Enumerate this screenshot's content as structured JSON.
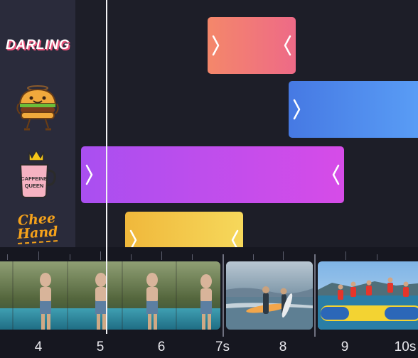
{
  "stickers": {
    "darling_text": "DARLING",
    "burger_icon": "burger-icon",
    "coffee_icon": "caffeine-queen-mug-icon",
    "coffee_text_1": "CAFFEINE",
    "coffee_text_2": "QUEEN",
    "chee_text_1": "Chee",
    "chee_text_2": "Hand"
  },
  "colors": {
    "darling_clip": [
      "#f4876a",
      "#ee6a87"
    ],
    "burger_clip": [
      "#4679e3",
      "#5a9ef6"
    ],
    "coffee_clip": [
      "#a94ff0",
      "#d64ce8"
    ],
    "chee_clip": [
      "#f0b83b",
      "#f6d85b"
    ]
  },
  "timeline": {
    "labels": [
      "4",
      "5",
      "6",
      "7s",
      "8",
      "9",
      "10s"
    ]
  },
  "videos": [
    {
      "name": "woman-pool-dance"
    },
    {
      "name": "beach-surfers"
    },
    {
      "name": "inflatable-water-park"
    }
  ]
}
